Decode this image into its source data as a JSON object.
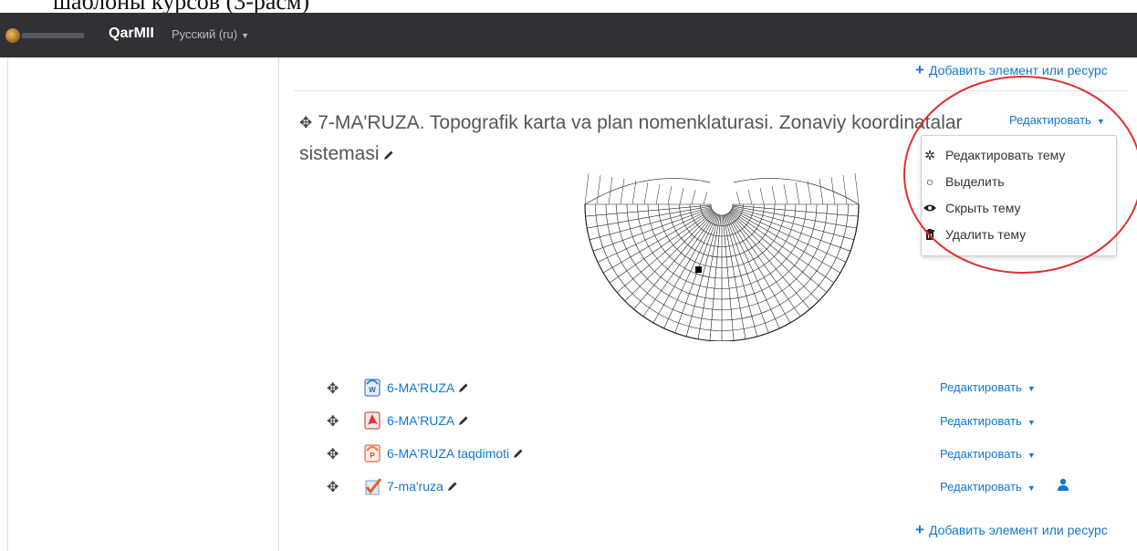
{
  "doc_fragment": "шаблоны курсов (3-расм)",
  "navbar": {
    "brand": "QarMII",
    "language": "Русский (ru)"
  },
  "add_resource_label": "Добавить элемент или ресурс",
  "section": {
    "title": "7-MA'RUZA. Topografik karta va plan nomenklaturasi. Zonaviy koordinatalar sistemasi",
    "edit_label": "Редактировать"
  },
  "dropdown": {
    "items": [
      {
        "label": "Редактировать тему",
        "icon": "gear-icon"
      },
      {
        "label": "Выделить",
        "icon": "circle-icon"
      },
      {
        "label": "Скрыть тему",
        "icon": "eye-icon"
      },
      {
        "label": "Удалить тему",
        "icon": "trash-icon"
      }
    ]
  },
  "activities": [
    {
      "name": "6-MA'RUZA",
      "icon": "word-doc-icon",
      "edit_label": "Редактировать"
    },
    {
      "name": "6-MA'RUZA",
      "icon": "pdf-icon",
      "edit_label": "Редактировать"
    },
    {
      "name": "6-MA'RUZA taqdimoti",
      "icon": "powerpoint-icon",
      "edit_label": "Редактировать"
    },
    {
      "name": "7-ma'ruza",
      "icon": "assignment-check-icon",
      "edit_label": "Редактировать"
    }
  ],
  "colors": {
    "navbar_bg": "#2f3134",
    "link": "#1177d1",
    "highlight_ring": "#e03030"
  }
}
